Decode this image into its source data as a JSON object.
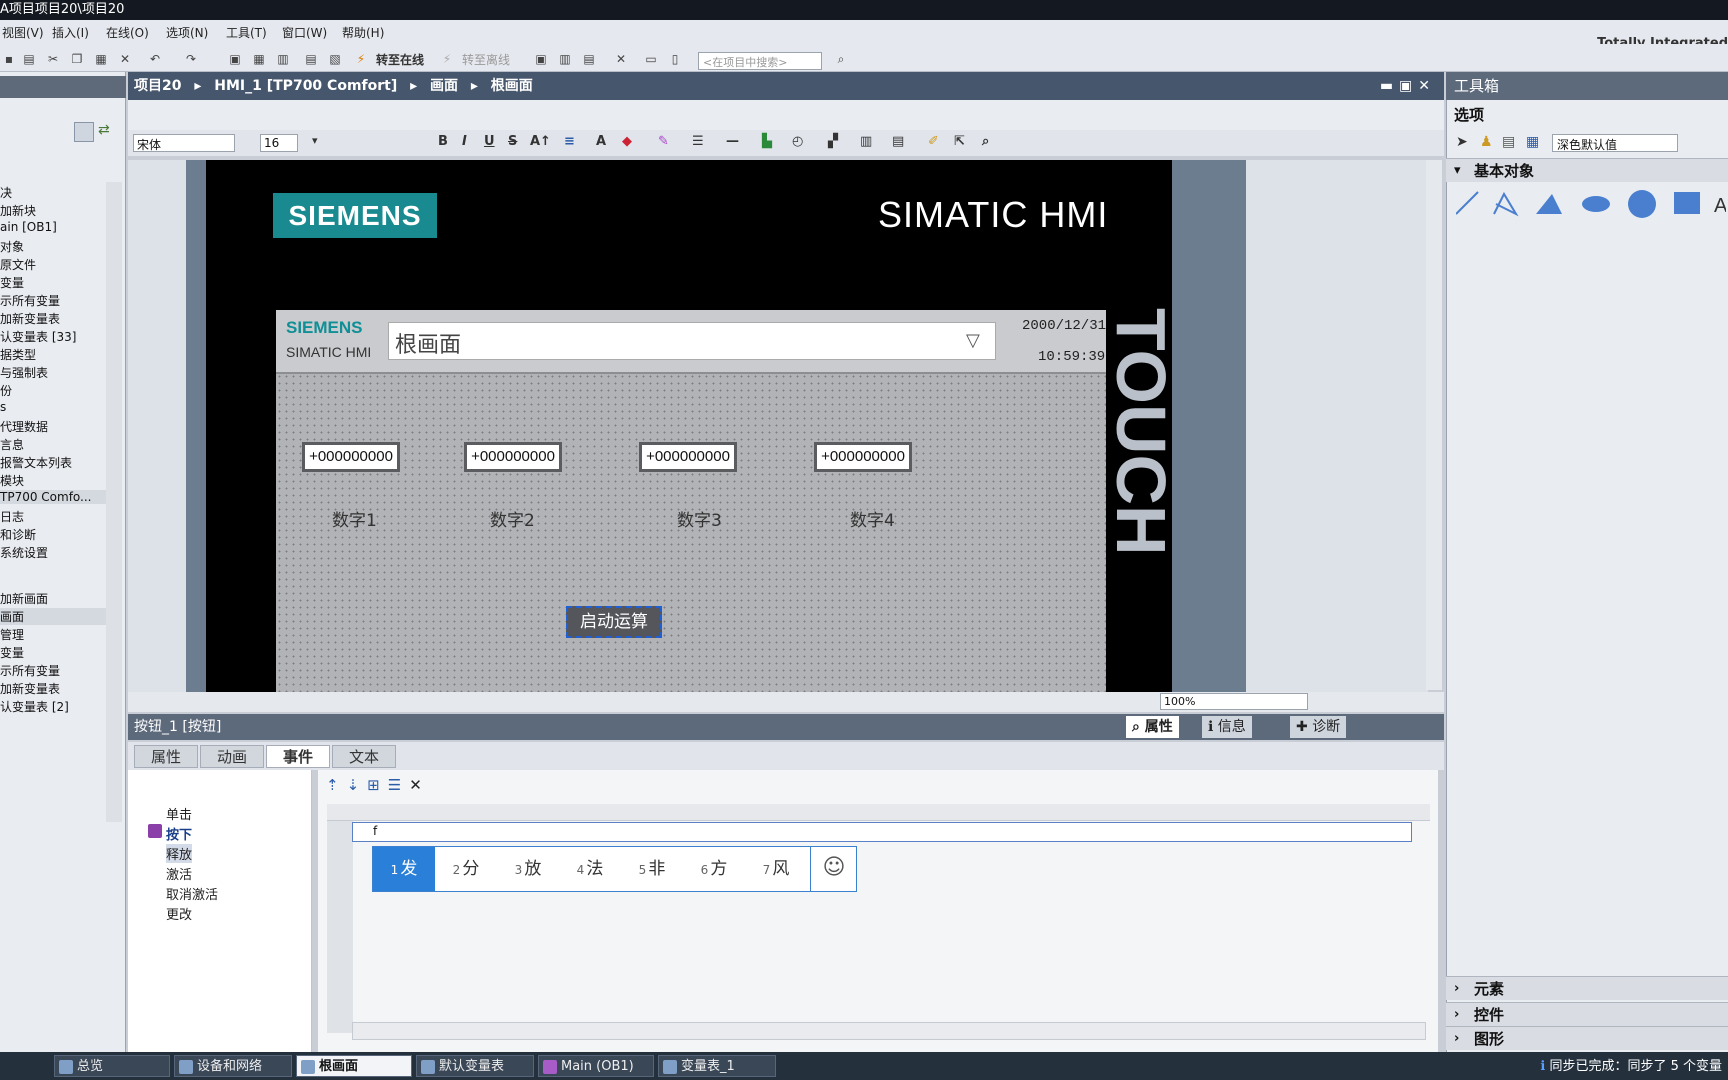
{
  "window": {
    "title": "A项目项目20\\项目20",
    "brand": "Totally Integrated"
  },
  "menu": [
    "视图(V)",
    "插入(I)",
    "在线(O)",
    "选项(N)",
    "工具(T)",
    "窗口(W)",
    "帮助(H)"
  ],
  "toolbar": {
    "go_online": "转至在线",
    "go_offline": "转至离线",
    "search_placeholder": "<在项目中搜索>"
  },
  "tree": [
    "决",
    "加新块",
    "ain [OB1]",
    "对象",
    "原文件",
    "变量",
    "示所有变量",
    "加新变量表",
    "认变量表 [33]",
    "据类型",
    "与强制表",
    "份",
    "s",
    "代理数据",
    "言息",
    "报警文本列表",
    "模块",
    "TP700 Comfo...",
    "日志",
    "和诊断",
    "系统设置",
    "",
    "加新画面",
    "画面",
    "管理",
    "变量",
    "示所有变量",
    "加新变量表",
    "认变量表 [2]"
  ],
  "editor": {
    "breadcrumb": [
      "项目20",
      "HMI_1 [TP700 Comfort]",
      "画面",
      "根画面"
    ],
    "font": "宋体",
    "font_size": "16",
    "zoom": "100%"
  },
  "hmi": {
    "brand": "SIEMENS",
    "product": "SIMATIC HMI",
    "touch": "TOUCH",
    "header_brand": "SIEMENS",
    "header_product": "SIMATIC HMI",
    "screen_name": "根画面",
    "date": "2000/12/31",
    "time": "10:59:39",
    "fields": [
      {
        "value": "+000000000",
        "label": "数字1"
      },
      {
        "value": "+000000000",
        "label": "数字2"
      },
      {
        "value": "+000000000",
        "label": "数字3"
      },
      {
        "value": "+000000000",
        "label": "数字4"
      }
    ],
    "start_button": "启动运算"
  },
  "inspector": {
    "title": "按钮_1 [按钮]",
    "top_tabs": [
      "属性",
      "信息",
      "诊断"
    ],
    "tabs": [
      "属性",
      "动画",
      "事件",
      "文本"
    ],
    "events": [
      "单击",
      "按下",
      "释放",
      "激活",
      "取消激活",
      "更改"
    ],
    "input_value": "f",
    "ime_candidates": [
      {
        "num": "1",
        "text": "发"
      },
      {
        "num": "2",
        "text": "分"
      },
      {
        "num": "3",
        "text": "放"
      },
      {
        "num": "4",
        "text": "法"
      },
      {
        "num": "5",
        "text": "非"
      },
      {
        "num": "6",
        "text": "方"
      },
      {
        "num": "7",
        "text": "风"
      }
    ]
  },
  "toolbox": {
    "title": "工具箱",
    "options": "选项",
    "color_default": "深色默认值",
    "basic": "基本对象",
    "sections": [
      "元素",
      "控件",
      "图形"
    ]
  },
  "taskbar": {
    "items": [
      "总览",
      "设备和网络",
      "根画面",
      "默认变量表",
      "Main (OB1)",
      "变量表_1"
    ],
    "status": "同步已完成：同步了 5 个变量"
  },
  "colors": {
    "siemens_teal": "#198a8f",
    "accent_blue": "#2a7fd8"
  }
}
